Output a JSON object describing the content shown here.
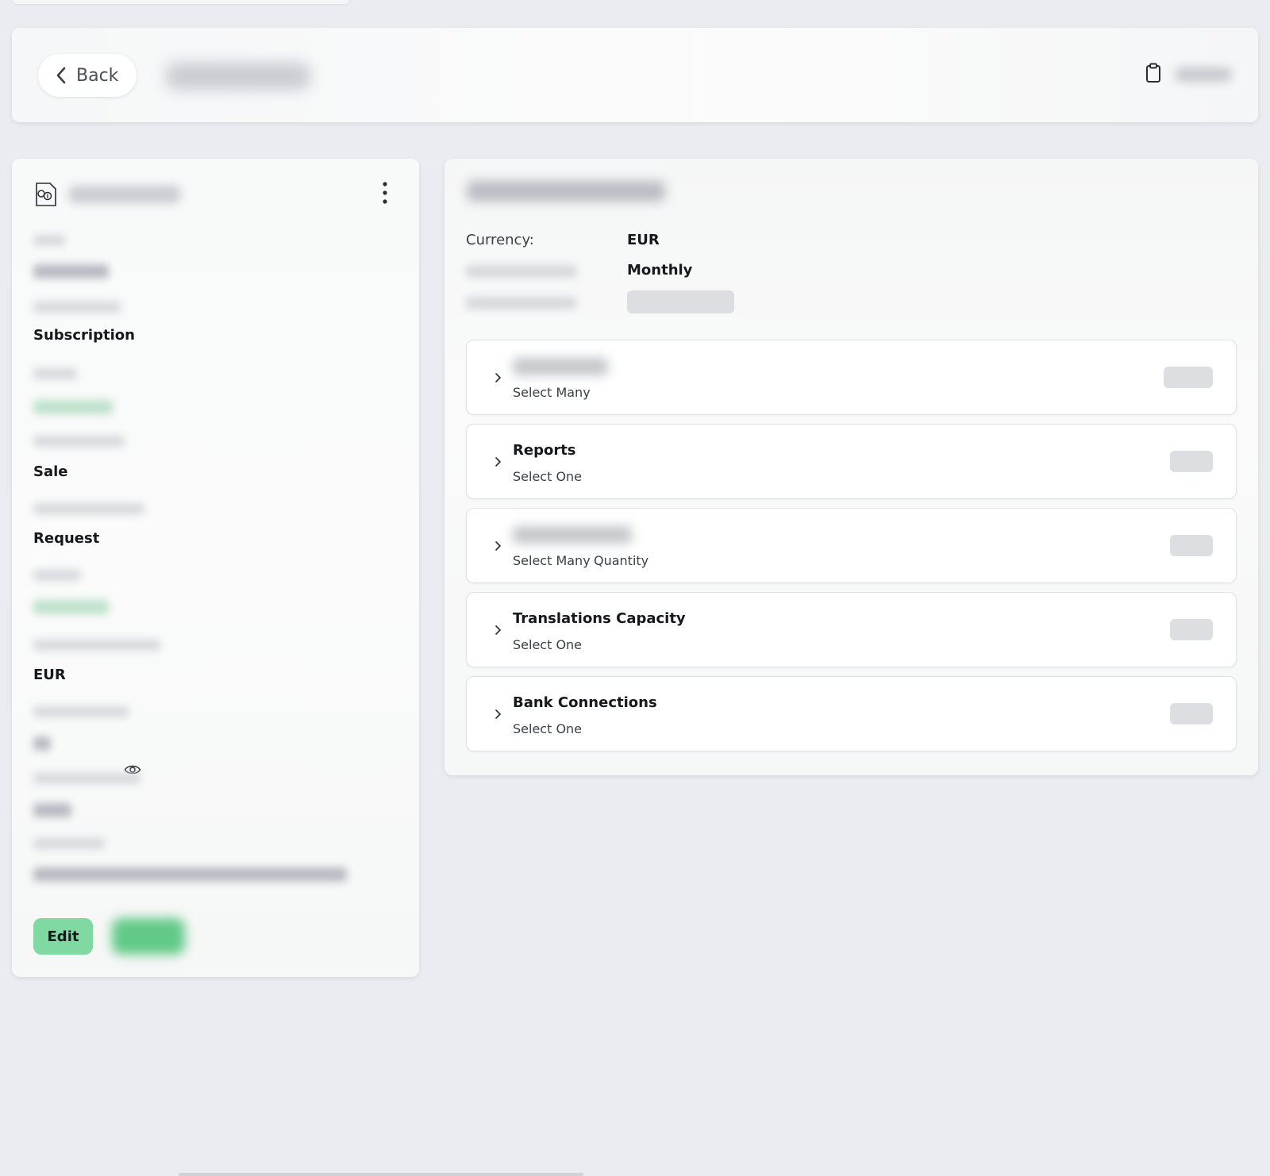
{
  "header": {
    "back_label": "Back"
  },
  "left_card": {
    "fields": [
      {
        "value": "Subscription"
      },
      {
        "value": "Sale"
      },
      {
        "value": "Request"
      },
      {
        "value": "EUR"
      }
    ],
    "edit_label": "Edit"
  },
  "right_card": {
    "currency_label": "Currency:",
    "currency_value": "EUR",
    "period_value": "Monthly",
    "options": [
      {
        "title": "",
        "tags": [
          "Select Many"
        ]
      },
      {
        "title": "Reports",
        "tags": [
          "Select One"
        ]
      },
      {
        "title": "",
        "tags": [
          "Select Many",
          "Quantity"
        ]
      },
      {
        "title": "Translations Capacity",
        "tags": [
          "Select One"
        ]
      },
      {
        "title": "Bank Connections",
        "tags": [
          "Select One"
        ]
      }
    ]
  },
  "colors": {
    "background": "#e9ecf0",
    "accent_green": "#7fd9a0",
    "text_primary": "#15181c"
  },
  "icons": [
    "chevron-left-icon",
    "clipboard-icon",
    "product-icon",
    "more-vertical-icon",
    "eye-icon",
    "chevron-right-icon"
  ]
}
